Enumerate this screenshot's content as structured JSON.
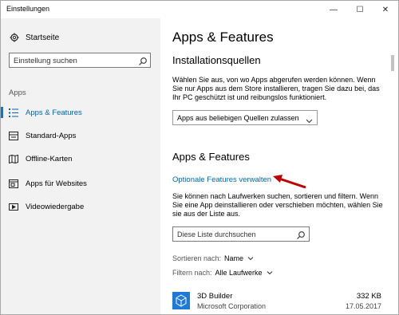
{
  "window": {
    "title": "Einstellungen",
    "controls": [
      "—",
      "☐",
      "✕"
    ]
  },
  "sidebar": {
    "home_label": "Startseite",
    "search_placeholder": "Einstellung suchen",
    "section_label": "Apps",
    "items": [
      {
        "label": "Apps & Features",
        "icon": "list-icon",
        "active": true
      },
      {
        "label": "Standard-Apps",
        "icon": "default-apps-icon",
        "active": false
      },
      {
        "label": "Offline-Karten",
        "icon": "map-icon",
        "active": false
      },
      {
        "label": "Apps für Websites",
        "icon": "websites-icon",
        "active": false
      },
      {
        "label": "Videowiedergabe",
        "icon": "video-icon",
        "active": false
      }
    ]
  },
  "main": {
    "page_title": "Apps & Features",
    "install_sources": {
      "heading": "Installationsquellen",
      "description": "Wählen Sie aus, von wo Apps abgerufen werden können. Wenn Sie nur Apps aus dem Store installieren, tragen Sie dazu bei, das Ihr PC geschützt ist und reibungslos funktioniert.",
      "dropdown_value": "Apps aus beliebigen Quellen zulassen"
    },
    "apps_features": {
      "heading": "Apps & Features",
      "optional_link": "Optionale Features verwalten",
      "description": "Sie können nach Laufwerken suchen, sortieren und filtern. Wenn Sie eine App deinstallieren oder verschieben möchten, wählen Sie sie aus der Liste aus.",
      "search_placeholder": "Diese Liste durchsuchen",
      "sort_label": "Sortieren nach:",
      "sort_value": "Name",
      "filter_label": "Filtern nach:",
      "filter_value": "Alle Laufwerke"
    },
    "apps": [
      {
        "name": "3D Builder",
        "publisher": "Microsoft Corporation",
        "size": "332 KB",
        "date": "17.05.2017"
      }
    ]
  },
  "colors": {
    "accent": "#0078d7",
    "link": "#0066b4",
    "arrow": "#c00000",
    "sidebar_bg": "#f2f2f2"
  }
}
